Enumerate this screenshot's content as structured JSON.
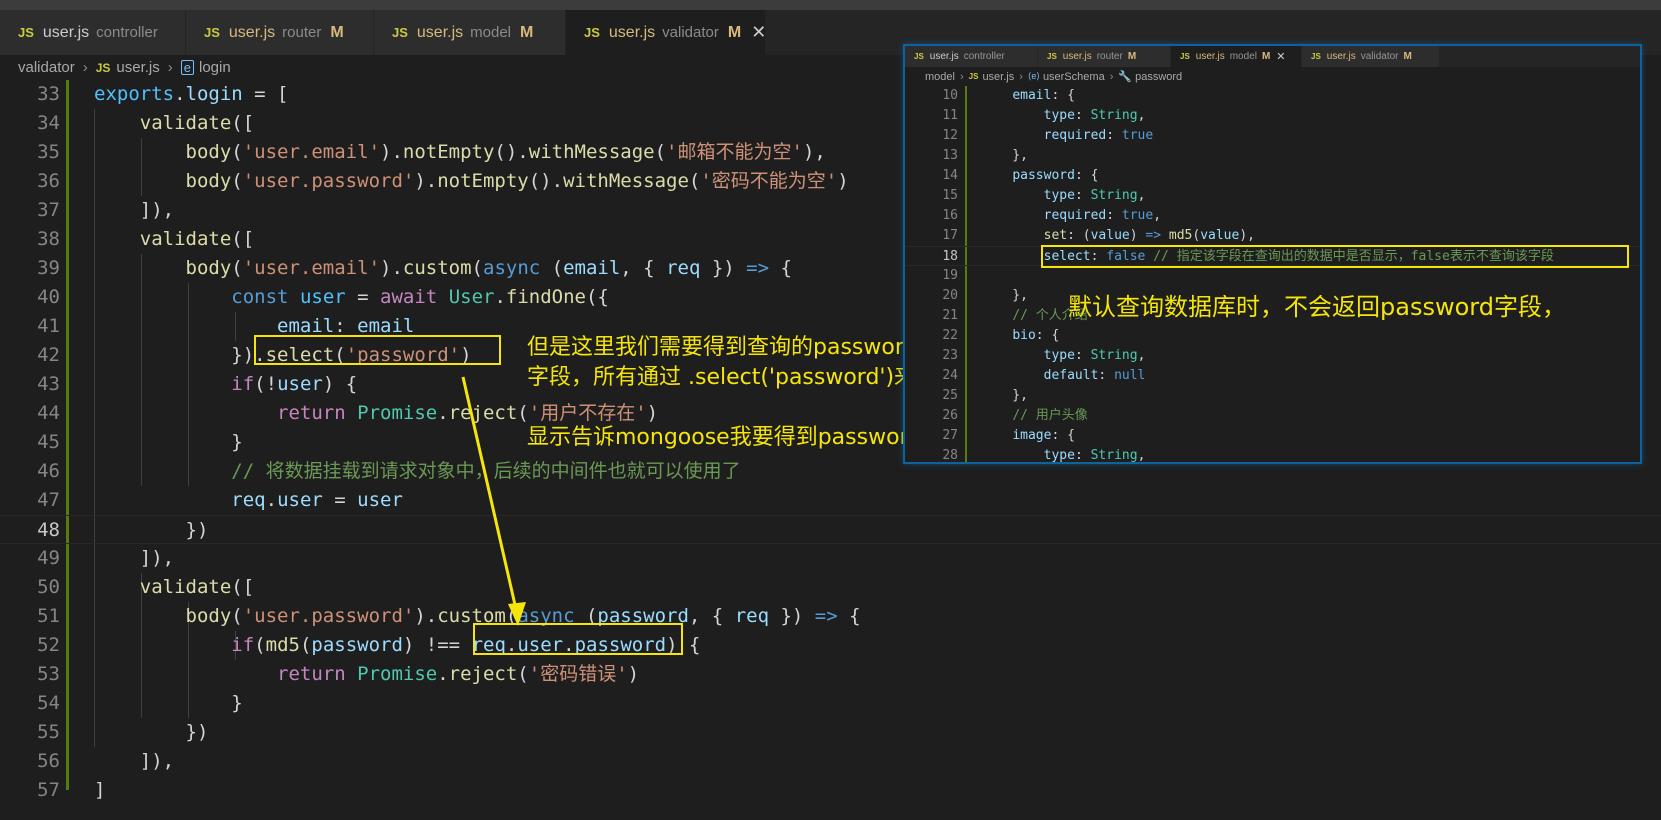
{
  "tabs": [
    {
      "name": "user.js",
      "folder": "controller",
      "modified": "",
      "active": false
    },
    {
      "name": "user.js",
      "folder": "router",
      "modified": "M",
      "active": false
    },
    {
      "name": "user.js",
      "folder": "model",
      "modified": "M",
      "active": false
    },
    {
      "name": "user.js",
      "folder": "validator",
      "modified": "M",
      "active": true
    }
  ],
  "js_badge": "JS",
  "close_glyph": "✕",
  "breadcrumb": {
    "folder": "validator",
    "file": "user.js",
    "symbol": "login"
  },
  "gutter_numbers": [
    "33",
    "34",
    "35",
    "36",
    "37",
    "38",
    "39",
    "40",
    "41",
    "42",
    "43",
    "44",
    "45",
    "46",
    "47",
    "48",
    "49",
    "50",
    "51",
    "52",
    "53",
    "54",
    "55",
    "56",
    "57"
  ],
  "annotations": {
    "select_note_1": "但是这里我们需要得到查询的password",
    "select_note_2": "字段，所有通过 .select('password')来",
    "select_note_3": "显示告诉mongoose我要得到password字段",
    "model_note": "默认查询数据库时，不会返回password字段，"
  },
  "peek": {
    "tabs": [
      {
        "name": "user.js",
        "folder": "controller",
        "modified": "",
        "active": false
      },
      {
        "name": "user.js",
        "folder": "router",
        "modified": "M",
        "active": false
      },
      {
        "name": "user.js",
        "folder": "model",
        "modified": "M",
        "active": true
      },
      {
        "name": "user.js",
        "folder": "validator",
        "modified": "M",
        "active": false
      }
    ],
    "breadcrumb": {
      "folder": "model",
      "file": "user.js",
      "schema": "userSchema",
      "field": "password"
    },
    "gutter_numbers": [
      "10",
      "11",
      "12",
      "13",
      "14",
      "15",
      "16",
      "17",
      "18",
      "19",
      "20",
      "21",
      "22",
      "23",
      "24",
      "25",
      "26",
      "27",
      "28"
    ]
  },
  "colors": {
    "accent_yellow": "#f5e50a",
    "editor_bg": "#1e1e1e",
    "peek_border": "#0e639c"
  },
  "icons": [
    "js-file-icon",
    "symbol-field-icon",
    "wrench-icon",
    "close-icon",
    "chevron-right-icon"
  ]
}
